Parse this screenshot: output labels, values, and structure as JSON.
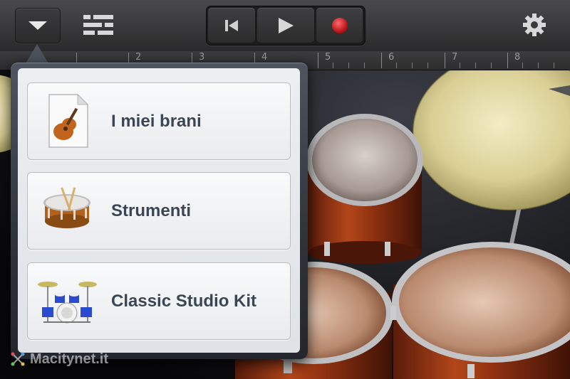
{
  "toolbar": {
    "menu_button": "dropdown-menu",
    "tracks_button": "tracks-view",
    "transport": {
      "rewind": "go-to-beginning",
      "play": "play",
      "record": "record"
    },
    "settings_button": "settings",
    "colors": {
      "record_red": "#e3141c",
      "toolbar_bg": "#3a3a3c"
    }
  },
  "ruler": {
    "marks": [
      "2",
      "3",
      "4",
      "5",
      "6",
      "7",
      "8"
    ]
  },
  "popover": {
    "items": [
      {
        "label": "I miei brani",
        "icon": "song-document-icon"
      },
      {
        "label": "Strumenti",
        "icon": "snare-drum-icon"
      },
      {
        "label": "Classic Studio Kit",
        "icon": "drum-kit-icon"
      }
    ],
    "label_color": "#3a4657"
  },
  "watermark": {
    "text": "Macitynet.it"
  }
}
